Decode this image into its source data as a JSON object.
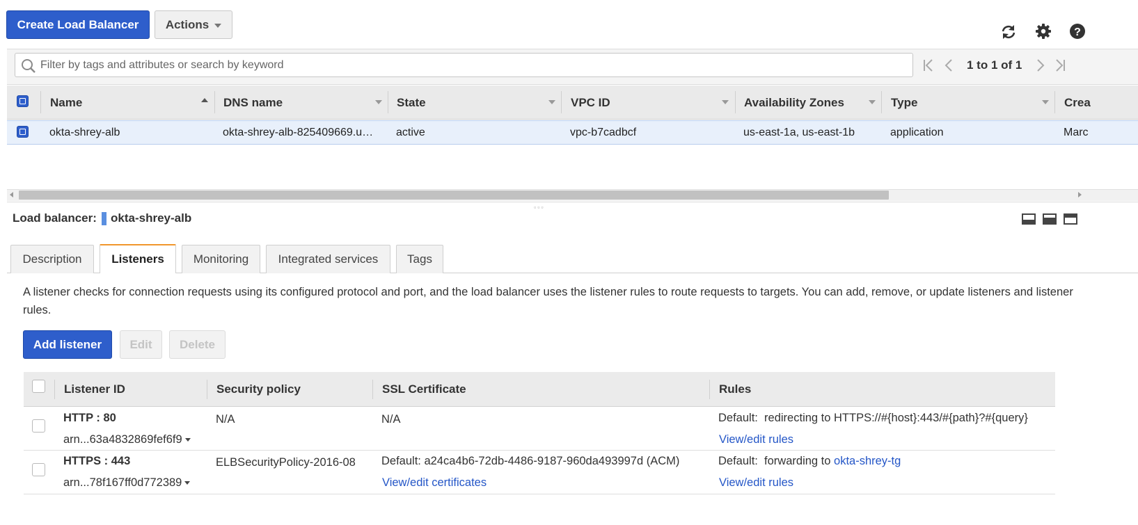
{
  "toolbar": {
    "create_label": "Create Load Balancer",
    "actions_label": "Actions"
  },
  "icons": {
    "refresh": "refresh-icon",
    "settings": "gear-icon",
    "help": "help-icon",
    "search": "search-icon"
  },
  "search": {
    "placeholder": "Filter by tags and attributes or search by keyword"
  },
  "pagination": {
    "text": "1 to 1 of 1"
  },
  "grid": {
    "columns": [
      "Name",
      "DNS name",
      "State",
      "VPC ID",
      "Availability Zones",
      "Type",
      "Crea"
    ],
    "rows": [
      {
        "name": "okta-shrey-alb",
        "dns": "okta-shrey-alb-825409669.u…",
        "state": "active",
        "vpc": "vpc-b7cadbcf",
        "zones": "us-east-1a, us-east-1b",
        "type": "application",
        "created": "Marc"
      }
    ]
  },
  "detail": {
    "label": "Load balancer:",
    "name": "okta-shrey-alb",
    "tabs": [
      "Description",
      "Listeners",
      "Monitoring",
      "Integrated services",
      "Tags"
    ],
    "active_tab": "Listeners",
    "description": "A listener checks for connection requests using its configured protocol and port, and the load balancer uses the listener rules to route requests to targets. You can add, remove, or update listeners and listener rules.",
    "buttons": {
      "add": "Add listener",
      "edit": "Edit",
      "delete": "Delete"
    }
  },
  "listeners": {
    "columns": [
      "Listener ID",
      "Security policy",
      "SSL Certificate",
      "Rules"
    ],
    "rows": [
      {
        "protocol": "HTTP : 80",
        "arn": "arn...63a4832869fef6f9",
        "policy": "N/A",
        "cert": "N/A",
        "cert_link": "",
        "rule_prefix": "Default:",
        "rule_text": "redirecting to HTTPS://#{host}:443/#{path}?#{query}",
        "rule_target": "",
        "rules_link": "View/edit rules"
      },
      {
        "protocol": "HTTPS : 443",
        "arn": "arn...78f167ff0d772389",
        "policy": "ELBSecurityPolicy-2016-08",
        "cert": "Default:  a24ca4b6-72db-4486-9187-960da493997d (ACM)",
        "cert_link": "View/edit certificates",
        "rule_prefix": "Default:",
        "rule_text": "forwarding to",
        "rule_target": "okta-shrey-tg",
        "rules_link": "View/edit rules"
      }
    ]
  },
  "colors": {
    "primary": "#2e5ecb",
    "link": "#2456c7",
    "active_tab_accent": "#f0962c",
    "selected_row": "#e8f0fb"
  }
}
